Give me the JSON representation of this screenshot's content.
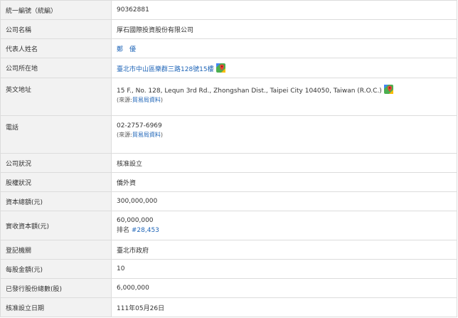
{
  "rows": {
    "tax_id": {
      "label": "統一編號（統編）",
      "value": "90362881"
    },
    "company_name": {
      "label": "公司名稱",
      "value": "厚石國際投資股份有限公司"
    },
    "representative": {
      "label": "代表人姓名",
      "value": "鄭　優"
    },
    "address": {
      "label": "公司所在地",
      "value": "臺北市中山區樂群三路128號15樓"
    },
    "english_address": {
      "label": "英文地址",
      "value": "15 F., No. 128, Lequn 3rd Rd., Zhongshan Dist., Taipei City 104050, Taiwan (R.O.C.)",
      "source_prefix": "(來源:",
      "source_link": "貿易局資料",
      "source_suffix": ")"
    },
    "phone": {
      "label": "電話",
      "value": "02-2757-6969",
      "source_prefix": "(來源:",
      "source_link": "貿易局資料",
      "source_suffix": ")"
    },
    "status": {
      "label": "公司狀況",
      "value": "核准設立"
    },
    "ownership": {
      "label": "股權狀況",
      "value": "僑外資"
    },
    "capital": {
      "label": "資本總額(元)",
      "value": "300,000,000"
    },
    "paid_capital": {
      "label": "實收資本額(元)",
      "value": "60,000,000",
      "rank_prefix": "排名 ",
      "rank_value": "#28,453"
    },
    "registrar": {
      "label": "登記機關",
      "value": "臺北市政府"
    },
    "par_value": {
      "label": "每股金額(元)",
      "value": "10"
    },
    "shares_issued": {
      "label": "已發行股份總數(股)",
      "value": "6,000,000"
    },
    "approval_date": {
      "label": "核准設立日期",
      "value": "111年05月26日"
    }
  },
  "icons": {
    "map": "google-maps-pin-icon"
  },
  "colors": {
    "label_bg": "#f2f2f2",
    "border": "#dcdcdc",
    "link": "#2066b8"
  }
}
